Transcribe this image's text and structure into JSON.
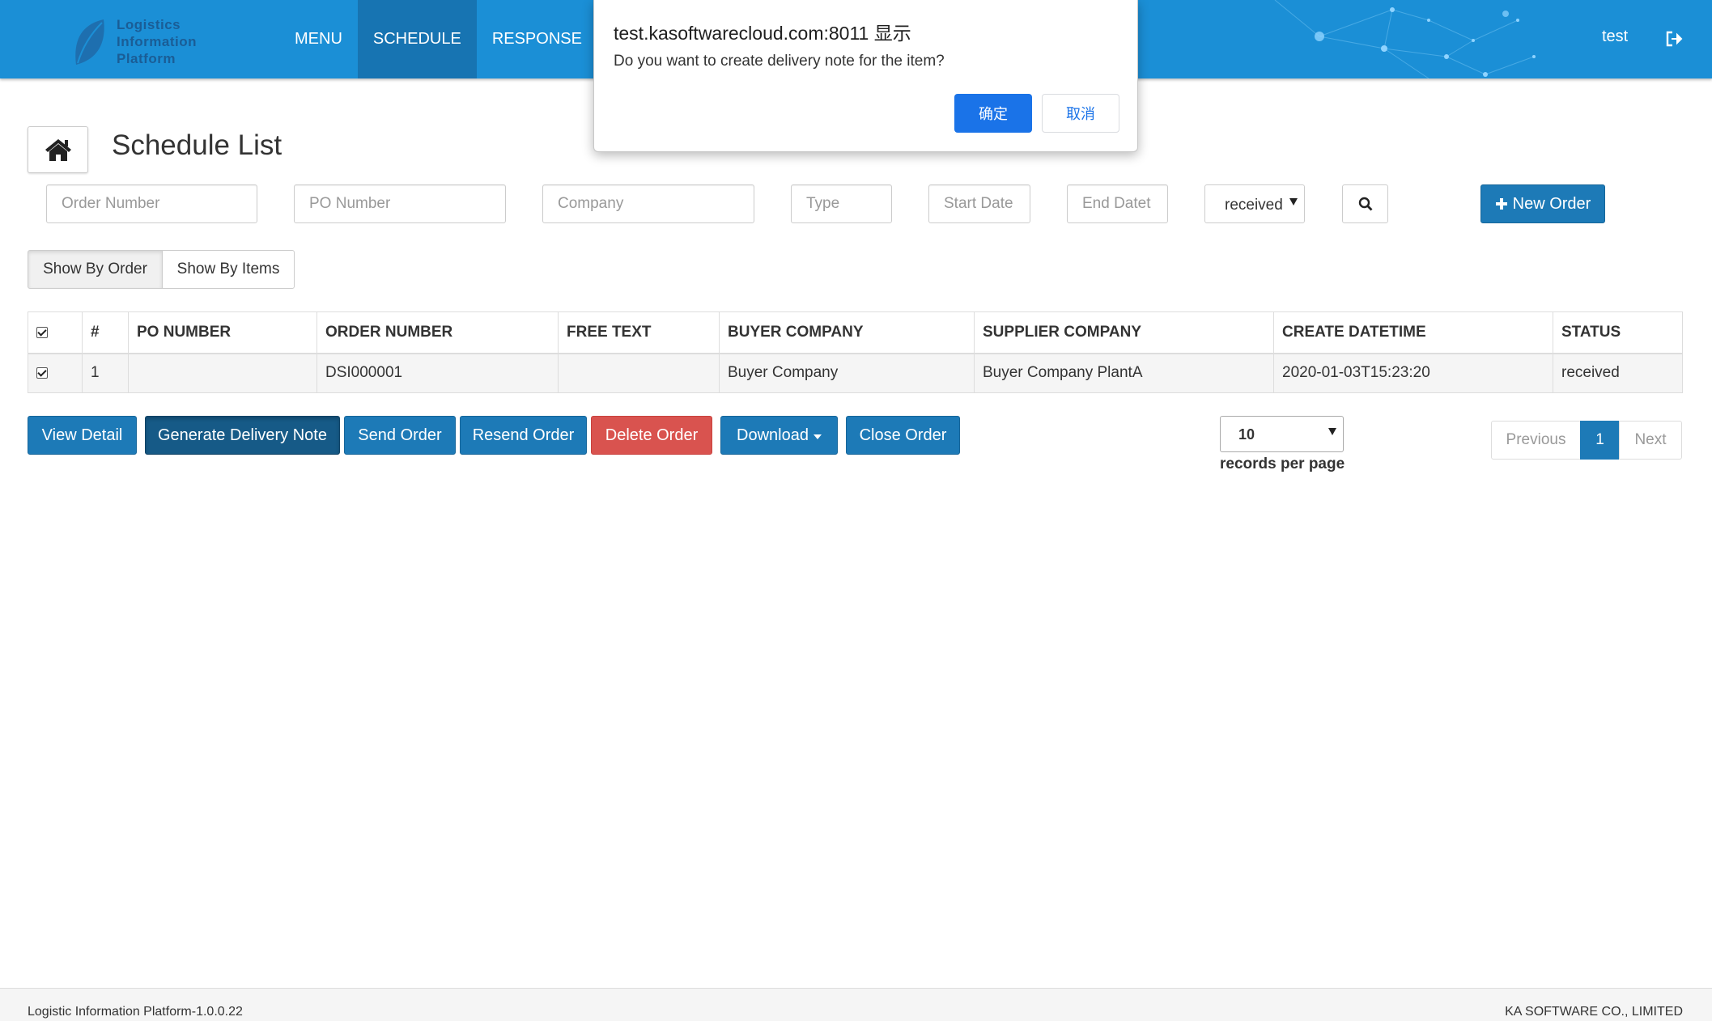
{
  "brand": {
    "logo_lines": [
      "Logistics",
      "Information",
      "Platform"
    ],
    "accent": "#1b8fd6"
  },
  "nav": {
    "items": [
      "MENU",
      "SCHEDULE",
      "RESPONSE"
    ],
    "active": "SCHEDULE"
  },
  "user": {
    "name": "test",
    "logout_icon": "sign-out-icon"
  },
  "page": {
    "title": "Schedule List",
    "home_icon": "home-icon"
  },
  "filters": {
    "order_number_placeholder": "Order Number",
    "po_number_placeholder": "PO Number",
    "company_placeholder": "Company",
    "type_placeholder": "Type",
    "start_date_placeholder": "Start Date",
    "end_date_placeholder": "End Datet",
    "status_value": "received",
    "search_icon": "search-icon",
    "new_order_label": "New Order"
  },
  "view_toggle": {
    "by_order": "Show By Order",
    "by_items": "Show By Items",
    "active": "Show By Order"
  },
  "table": {
    "columns": [
      "#",
      "PO NUMBER",
      "ORDER NUMBER",
      "FREE TEXT",
      "BUYER COMPANY",
      "SUPPLIER COMPANY",
      "CREATE DATETIME",
      "STATUS"
    ],
    "rows": [
      {
        "checked": true,
        "index": "1",
        "po_number": "",
        "order_number": "DSI000001",
        "free_text": "",
        "buyer_company": "Buyer Company",
        "supplier_company": "Buyer Company PlantA",
        "create_datetime": "2020-01-03T15:23:20",
        "status": "received"
      }
    ]
  },
  "actions": {
    "view_detail": "View Detail",
    "generate_delivery_note": "Generate Delivery Note",
    "send_order": "Send Order",
    "resend_order": "Resend Order",
    "delete_order": "Delete Order",
    "download": "Download",
    "close_order": "Close Order"
  },
  "paging": {
    "page_size": "10",
    "page_size_label": "records per page",
    "previous": "Previous",
    "current": "1",
    "next": "Next"
  },
  "footer": {
    "version": "Logistic Information Platform-1.0.0.22",
    "company": "KA SOFTWARE CO., LIMITED"
  },
  "dialog": {
    "title": "test.kasoftwarecloud.com:8011 显示",
    "message": "Do you want to create delivery note for the item?",
    "ok": "确定",
    "cancel": "取消"
  }
}
